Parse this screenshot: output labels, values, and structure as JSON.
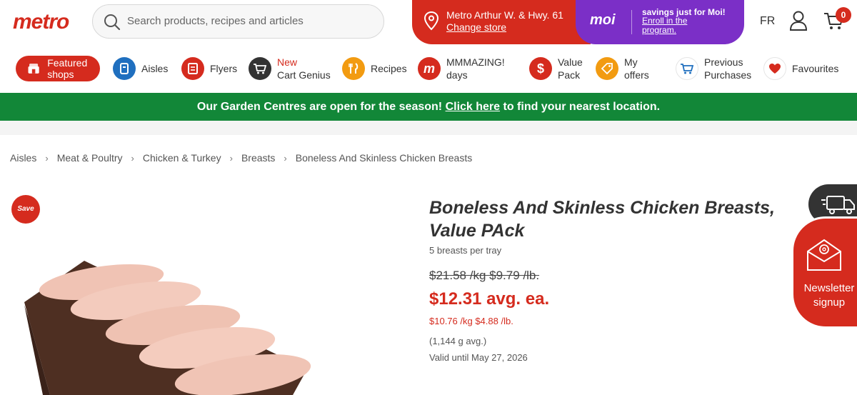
{
  "header": {
    "logo": "metro",
    "search_placeholder": "Search products, recipes and articles",
    "store_name": "Metro Arthur W. & Hwy. 61",
    "change_store": "Change store",
    "moi_logo": "moi",
    "moi_tagline": "savings just for Moi!",
    "moi_enroll": "Enroll in the program.",
    "lang": "FR",
    "cart_count": "0"
  },
  "nav": {
    "featured": "Featured shops",
    "items": [
      {
        "label": "Aisles",
        "icon": "aisles-icon",
        "color": "#1f6fbf"
      },
      {
        "label": "Flyers",
        "icon": "flyers-icon",
        "color": "#d52b1e"
      },
      {
        "label_line1": "New",
        "label_line2": "Cart Genius",
        "icon": "cart-genius-icon",
        "color": "#333333"
      },
      {
        "label": "Recipes",
        "icon": "recipes-icon",
        "color": "#f29b11"
      },
      {
        "label_line1": "MMMAZING!",
        "label_line2": "days",
        "icon": "mmmazing-icon",
        "color": "#d52b1e"
      },
      {
        "label_line1": "Value",
        "label_line2": "Pack",
        "icon": "value-pack-icon",
        "color": "#d52b1e"
      },
      {
        "label_line1": "My",
        "label_line2": "offers",
        "icon": "offers-icon",
        "color": "#f29b11"
      },
      {
        "label_line1": "Previous",
        "label_line2": "Purchases",
        "icon": "previous-purchases-icon",
        "color": "#1f6fbf"
      },
      {
        "label": "Favourites",
        "icon": "heart-icon",
        "color": "#d52b1e"
      }
    ]
  },
  "banner": {
    "before": "Our Garden Centres are open for the season! ",
    "link": "Click here",
    "after": " to find your nearest location."
  },
  "breadcrumb": [
    "Aisles",
    "Meat & Poultry",
    "Chicken & Turkey",
    "Breasts",
    "Boneless And Skinless Chicken Breasts"
  ],
  "product": {
    "badge": "Save",
    "title": "Boneless And Skinless Chicken Breasts, Value PAck",
    "subtitle": "5 breasts per tray",
    "old_price": "$21.58 /kg $9.79 /lb.",
    "price": "$12.31 avg. ea.",
    "unit_price": "$10.76 /kg $4.88 /lb.",
    "avg_weight": "(1,144 g avg.)",
    "valid_until": "Valid until May 27, 2026"
  },
  "floating": {
    "newsletter": "Newsletter signup"
  },
  "colors": {
    "brand_red": "#d52b1e",
    "moi_purple": "#7b2fc7",
    "banner_green": "#128738"
  }
}
